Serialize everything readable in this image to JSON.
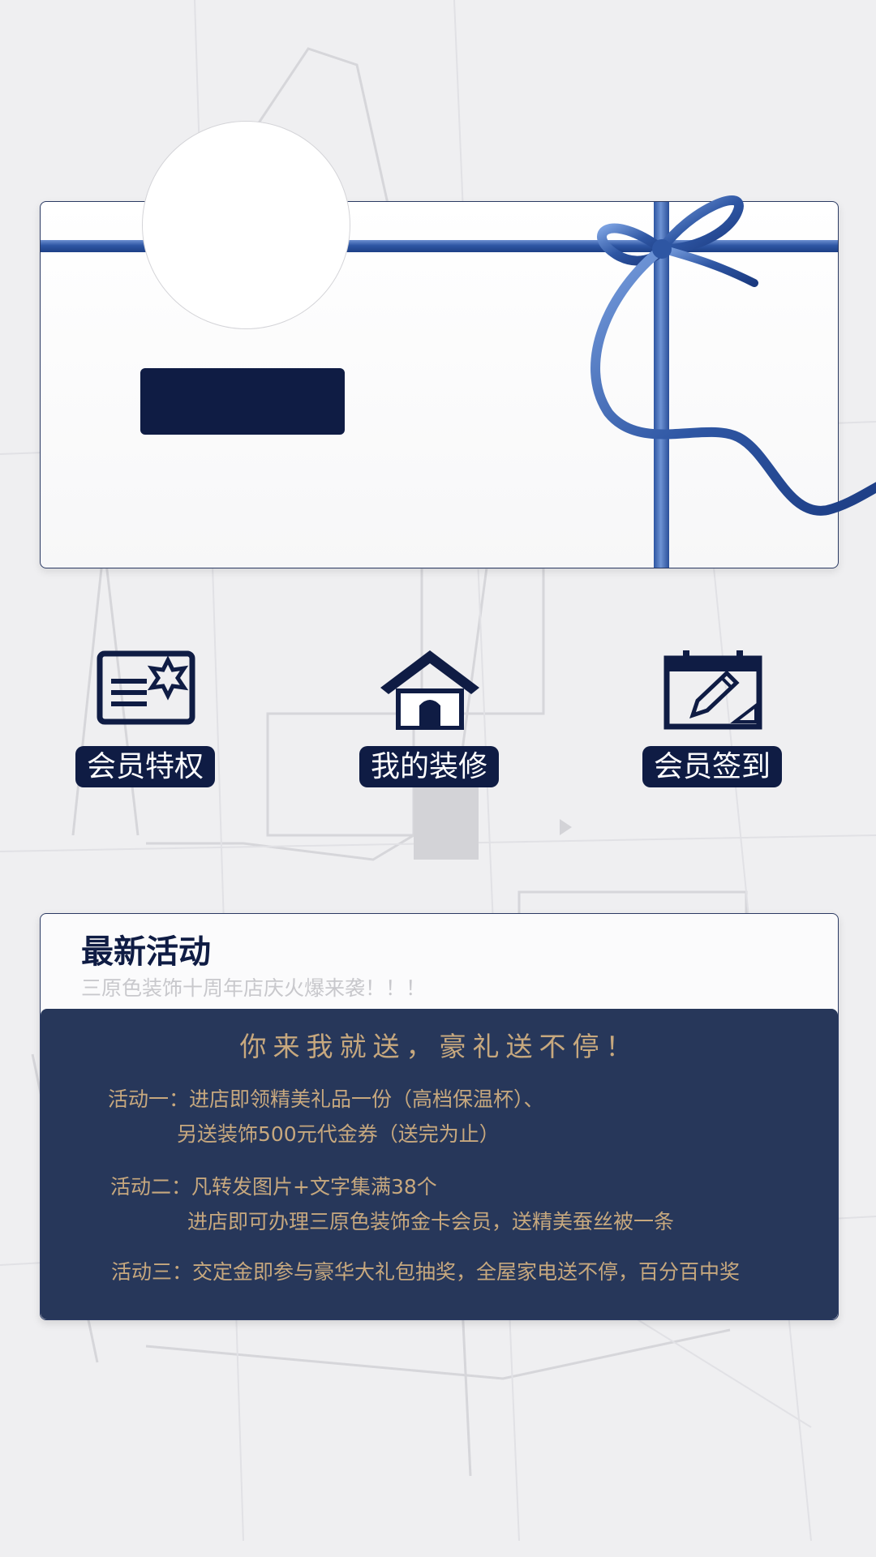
{
  "colors": {
    "navy": "#0f1c44",
    "panel": "#27375a",
    "gold": "#c7a87e",
    "ribbon": "#2e56a3",
    "background": "#efeff1"
  },
  "card": {
    "avatar_icon": "avatar-placeholder",
    "name_plate_text": ""
  },
  "actions": [
    {
      "icon": "membership-card-icon",
      "label": "会员特权"
    },
    {
      "icon": "house-icon",
      "label": "我的装修"
    },
    {
      "icon": "calendar-sign-icon",
      "label": "会员签到"
    }
  ],
  "news": {
    "title": "最新活动",
    "subtitle": "三原色装饰十周年店庆火爆来袭！！！",
    "headline": "你来我就送，豪礼送不停！",
    "items": [
      {
        "line1": "活动一：进店即领精美礼品一份（高档保温杯）、",
        "line2": "另送装饰500元代金券（送完为止）"
      },
      {
        "line1": "活动二：凡转发图片+文字集满38个",
        "line2": "进店即可办理三原色装饰金卡会员，送精美蚕丝被一条"
      },
      {
        "line1": "活动三：交定金即参与豪华大礼包抽奖，全屋家电送不停，百分百中奖"
      }
    ]
  }
}
